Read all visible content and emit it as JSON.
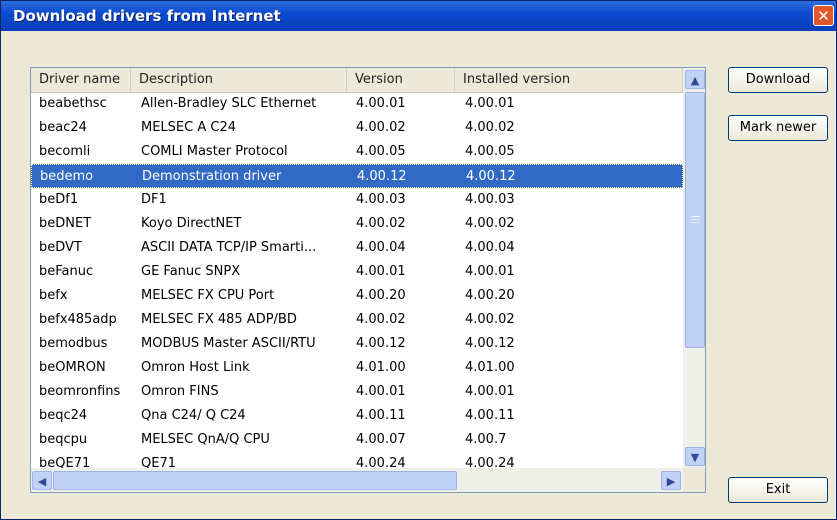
{
  "window": {
    "title": "Download drivers from Internet",
    "close_glyph": "✕"
  },
  "list": {
    "columns": [
      "Driver name",
      "Description",
      "Version",
      "Installed version"
    ],
    "selected_index": 3,
    "rows": [
      [
        "beabethsc",
        "Allen-Bradley SLC Ethernet",
        "4.00.01",
        "4.00.01"
      ],
      [
        "beac24",
        "MELSEC A C24",
        "4.00.02",
        "4.00.02"
      ],
      [
        "becomli",
        "COMLI Master Protocol",
        "4.00.05",
        "4.00.05"
      ],
      [
        "bedemo",
        "Demonstration driver",
        "4.00.12",
        "4.00.12"
      ],
      [
        "beDf1",
        "DF1",
        "4.00.03",
        "4.00.03"
      ],
      [
        "beDNET",
        "Koyo DirectNET",
        "4.00.02",
        "4.00.02"
      ],
      [
        "beDVT",
        "ASCII DATA TCP/IP Smarti...",
        "4.00.04",
        "4.00.04"
      ],
      [
        "beFanuc",
        "GE Fanuc SNPX",
        "4.00.01",
        "4.00.01"
      ],
      [
        "befx",
        "MELSEC FX CPU Port",
        "4.00.20",
        "4.00.20"
      ],
      [
        "befx485adp",
        "MELSEC FX 485 ADP/BD",
        "4.00.02",
        "4.00.02"
      ],
      [
        "bemodbus",
        "MODBUS Master ASCII/RTU",
        "4.00.12",
        "4.00.12"
      ],
      [
        "beOMRON",
        "Omron Host Link",
        "4.01.00",
        "4.01.00"
      ],
      [
        "beomronfins",
        "Omron FINS",
        "4.00.01",
        "4.00.01"
      ],
      [
        "beqc24",
        "Qna C24/ Q C24",
        "4.00.11",
        "4.00.11"
      ],
      [
        "beqcpu",
        "MELSEC QnA/Q CPU",
        "4.00.07",
        "4.00.7"
      ],
      [
        "beQE71",
        "QE71",
        "4.00.24",
        "4.00.24"
      ]
    ]
  },
  "buttons": {
    "download": "Download",
    "mark_newer": "Mark newer",
    "exit": "Exit"
  },
  "scroll": {
    "up": "▲",
    "down": "▼",
    "left": "◀",
    "right": "▶"
  }
}
